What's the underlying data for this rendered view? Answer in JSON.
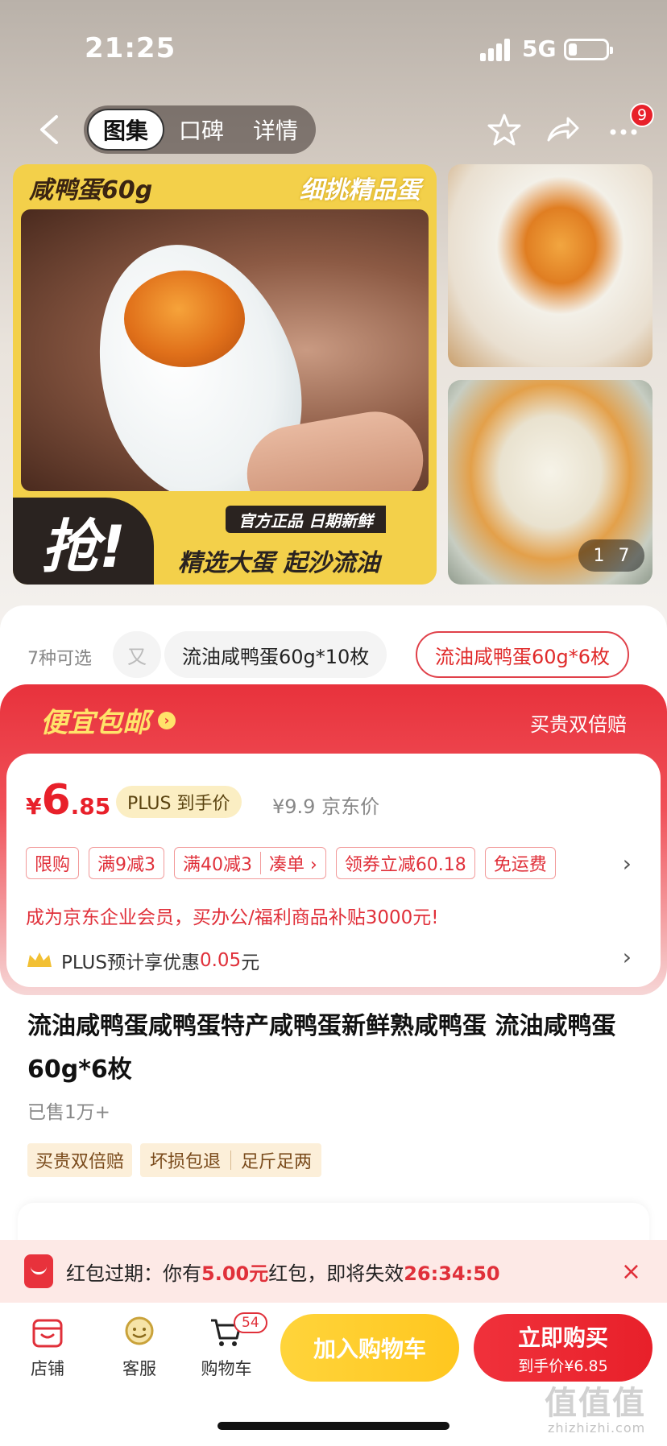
{
  "status_bar": {
    "time": "21:25",
    "network": "5G"
  },
  "nav": {
    "tabs": [
      "图集",
      "口碑",
      "详情"
    ],
    "active_tab": 0,
    "more_badge": "9"
  },
  "gallery": {
    "main_title_left": "咸鸭蛋60g",
    "main_title_right": "细挑精品蛋",
    "grab_text": "抢!",
    "tagline": "官方正品 日期新鲜",
    "slogan": "精选大蛋 起沙流油",
    "page_current": "1",
    "page_total": "7"
  },
  "sku": {
    "count_text": "7种可选",
    "partial_chip": "又",
    "chips": [
      "流油咸鸭蛋60g*10枚",
      "流油咸鸭蛋60g*6枚"
    ],
    "selected_index": 1
  },
  "promo": {
    "title": "便宜包邮",
    "title_arrow": "›",
    "right_text": "买贵双倍赔"
  },
  "price": {
    "currency": "¥",
    "integer": "6",
    "decimal": ".85",
    "plus_label": "PLUS 到手价",
    "orig_price": "¥9.9 京东价",
    "tags": [
      "限购",
      "满9减3",
      "满40减3",
      "凑单 ›",
      "领券立减60.18",
      "免运费"
    ],
    "corp_text": "成为京东企业会员，买办公/福利商品补贴3000元!",
    "plus_prefix": "PLUS预计享优惠",
    "plus_amount": "0.05",
    "plus_suffix": "元",
    "chevron": "›"
  },
  "product": {
    "title": "流油咸鸭蛋咸鸭蛋特产咸鸭蛋新鲜熟咸鸭蛋 流油咸鸭蛋60g*6枚",
    "sold": "已售1万+",
    "service_first": "买贵双倍赔",
    "service_group": [
      "坏损包退",
      "足斤足两"
    ]
  },
  "banner": {
    "prefix": "红包过期：你有",
    "amount": "5.00元",
    "middle": "红包，即将失效",
    "countdown": "26:34:50",
    "close": "×"
  },
  "bottom": {
    "shop": "店铺",
    "service": "客服",
    "cart": "购物车",
    "cart_count": "54",
    "add_cart": "加入购物车",
    "buy_now": "立即购买",
    "buy_price": "到手价¥6.85"
  },
  "watermark": {
    "main": "值值值",
    "sub": "zhizhizhi.com"
  },
  "colors": {
    "accent_red": "#e8202a",
    "yellow": "#ffd43b",
    "promo_yellow": "#ffe36a"
  }
}
